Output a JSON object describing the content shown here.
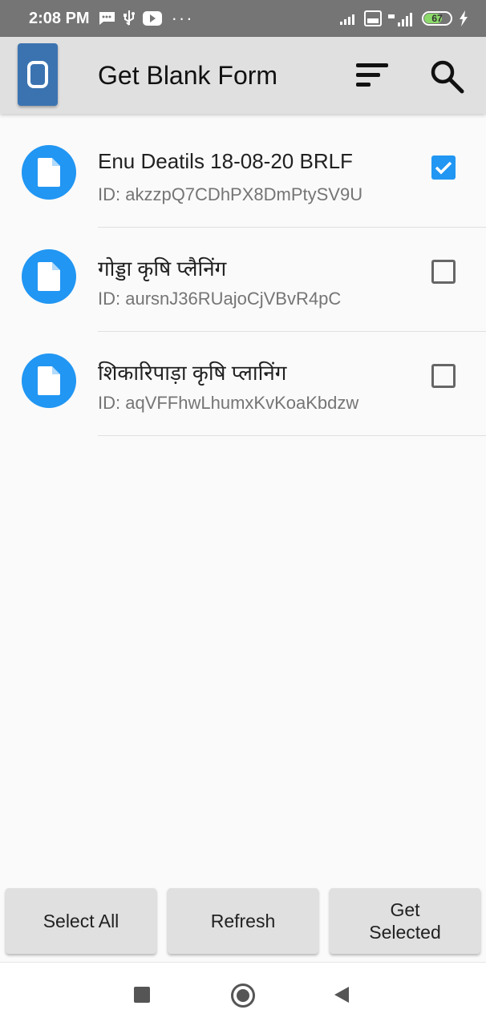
{
  "status_bar": {
    "time": "2:08 PM",
    "battery": "67",
    "icons": [
      "message-icon",
      "usb-icon",
      "youtube-icon",
      "signal-icon",
      "volte-icon",
      "4g-signal-icon",
      "battery-icon",
      "charging-icon"
    ]
  },
  "toolbar": {
    "title": "Get Blank Form",
    "icons": [
      "app-logo-icon",
      "sort-icon",
      "search-icon"
    ]
  },
  "forms": [
    {
      "title": "Enu Deatils 18-08-20 BRLF",
      "id": "ID: akzzpQ7CDhPX8DmPtySV9U",
      "checked": true
    },
    {
      "title": "गोड्डा कृषि  प्लैनिंग",
      "id": "ID: aursnJ36RUajoCjVBvR4pC",
      "checked": false
    },
    {
      "title": "शिकारिपाड़ा कृषि प्लानिंग",
      "id": "ID: aqVFFhwLhumxKvKoaKbdzw",
      "checked": false
    }
  ],
  "buttons": {
    "select_all": "Select All",
    "refresh": "Refresh",
    "get_selected": "Get\nSelected"
  },
  "colors": {
    "accent": "#2196f3",
    "app_icon": "#3b73b1",
    "toolbar_bg": "#e0e0e0",
    "status_bar_bg": "#757575"
  }
}
